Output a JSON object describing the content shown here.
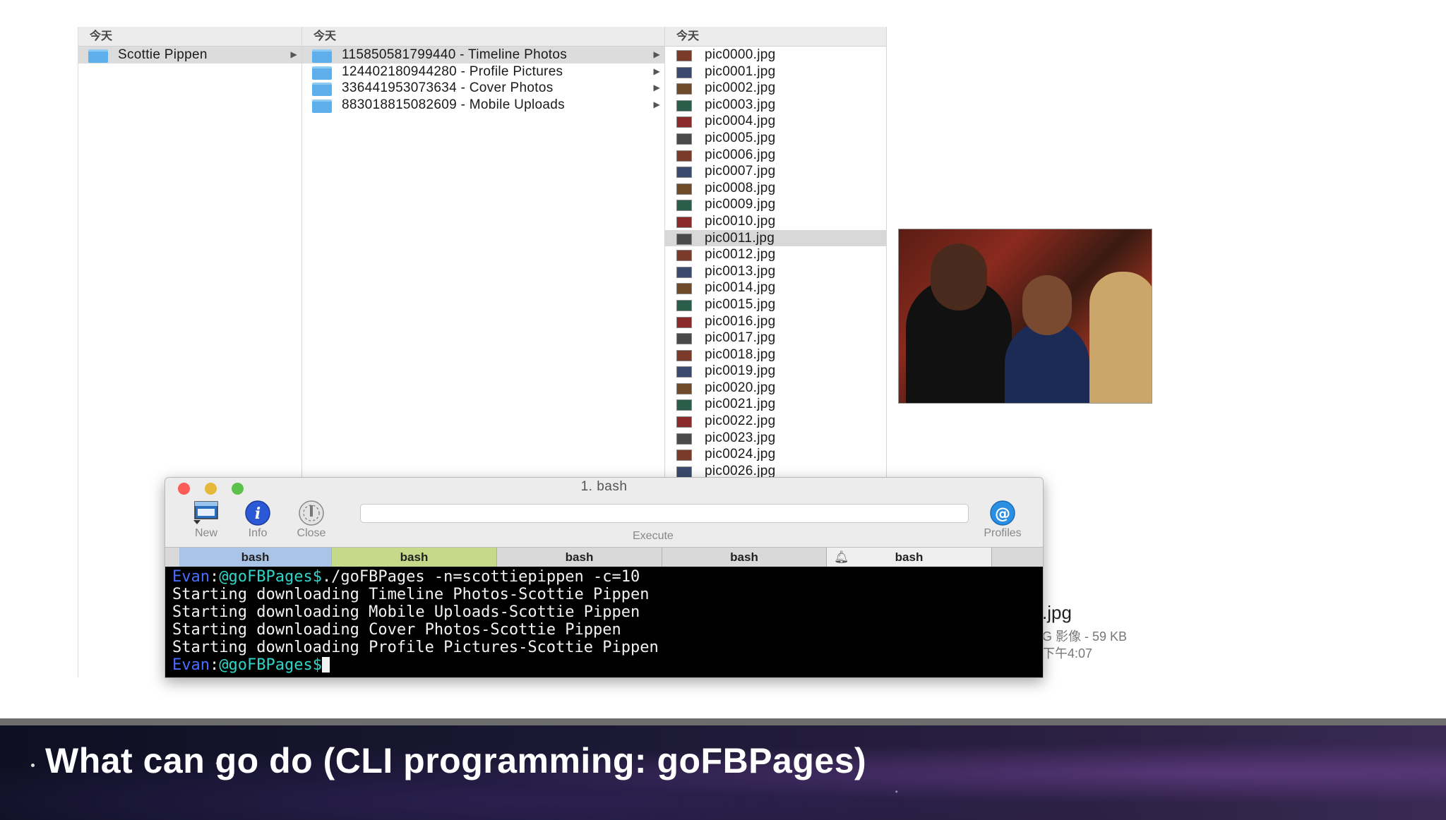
{
  "finder": {
    "columns": [
      {
        "header": "今天",
        "items": [
          {
            "label": "Scottie Pippen",
            "selected": true
          }
        ]
      },
      {
        "header": "今天",
        "items": [
          {
            "label": "115850581799440 - Timeline Photos",
            "selected": true
          },
          {
            "label": "124402180944280 - Profile Pictures"
          },
          {
            "label": "336441953073634 - Cover Photos"
          },
          {
            "label": "883018815082609 - Mobile Uploads"
          }
        ]
      },
      {
        "header": "今天",
        "items": [
          "pic0000.jpg",
          "pic0001.jpg",
          "pic0002.jpg",
          "pic0003.jpg",
          "pic0004.jpg",
          "pic0005.jpg",
          "pic0006.jpg",
          "pic0007.jpg",
          "pic0008.jpg",
          "pic0009.jpg",
          "pic0010.jpg",
          "pic0011.jpg",
          "pic0012.jpg",
          "pic0013.jpg",
          "pic0014.jpg",
          "pic0015.jpg",
          "pic0016.jpg",
          "pic0017.jpg",
          "pic0018.jpg",
          "pic0019.jpg",
          "pic0020.jpg",
          "pic0021.jpg",
          "pic0022.jpg",
          "pic0023.jpg",
          "pic0024.jpg",
          "pic0026.jpg"
        ],
        "selected": "pic0011.jpg"
      }
    ],
    "preview_info": {
      "name_fragment": ".jpg",
      "kind_size": "G 影像 - 59 KB",
      "time": "下午4:07"
    }
  },
  "terminal": {
    "title": "1. bash",
    "toolbar": {
      "new": "New",
      "info": "Info",
      "close": "Close",
      "execute": "Execute",
      "profiles": "Profiles"
    },
    "tabs": [
      "bash",
      "bash",
      "bash",
      "bash",
      "bash"
    ],
    "user": "Evan",
    "host": "@goFBPages",
    "prompt_suffix": "$",
    "command": "./goFBPages -n=scottiepippen -c=10",
    "output": [
      "Starting downloading Timeline Photos-Scottie Pippen",
      "Starting downloading Mobile Uploads-Scottie Pippen",
      "Starting downloading Cover Photos-Scottie Pippen",
      "Starting downloading Profile Pictures-Scottie Pippen"
    ]
  },
  "slide": {
    "title": "What can go do (CLI programming: goFBPages)"
  },
  "colors": {
    "folder": "#5db0ec",
    "selection": "#dcdcdc",
    "prompt_user": "#4a6cff",
    "prompt_host": "#2fd6c8",
    "tab_active_blue": "#a9c4e6",
    "tab_active_green": "#c6d98b"
  }
}
